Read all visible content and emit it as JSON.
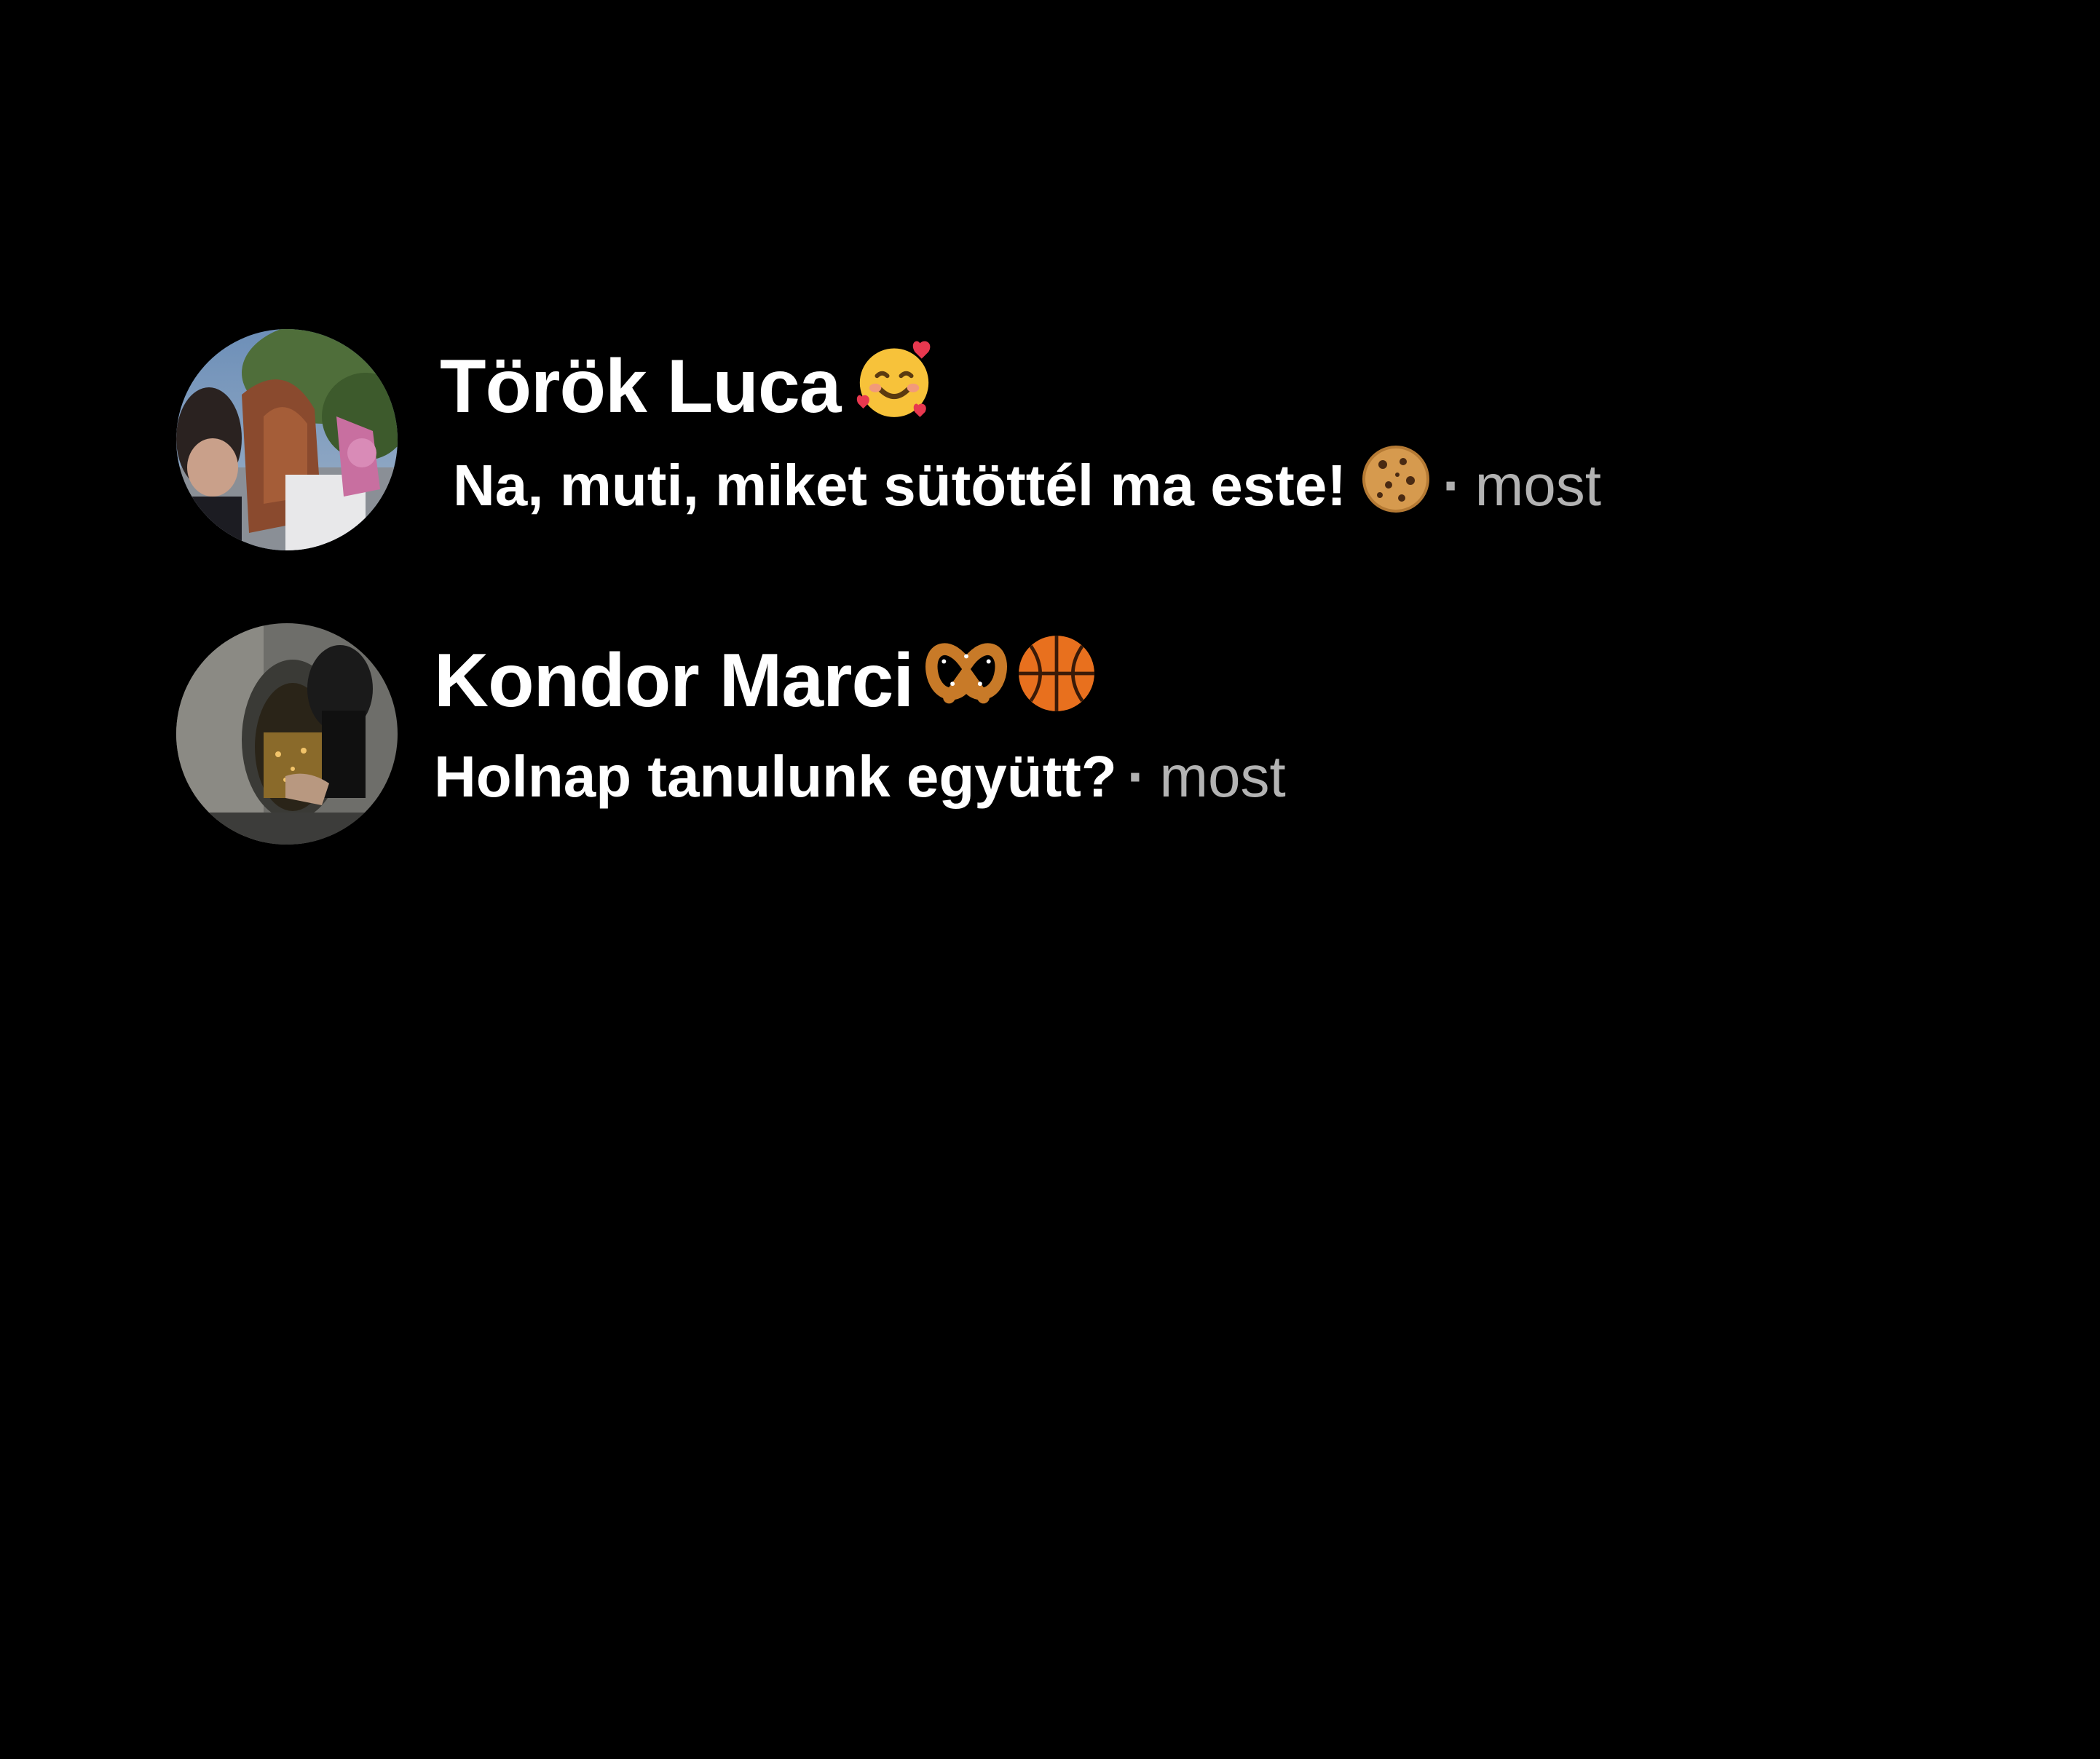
{
  "chats": [
    {
      "name": "Török Luca",
      "name_emoji": "smiling-face-with-hearts",
      "message": "Na, muti, miket sütöttél ma este!",
      "message_emoji": "cookie",
      "separator": "·",
      "time": "most"
    },
    {
      "name": "Kondor Marci",
      "name_emojis": [
        "pretzel",
        "basketball"
      ],
      "message": "Holnap tanulunk együtt?",
      "separator": "·",
      "time": "most"
    }
  ],
  "colors": {
    "background": "#000000",
    "primary_text": "#ffffff",
    "secondary_text": "#b3b3b3"
  }
}
